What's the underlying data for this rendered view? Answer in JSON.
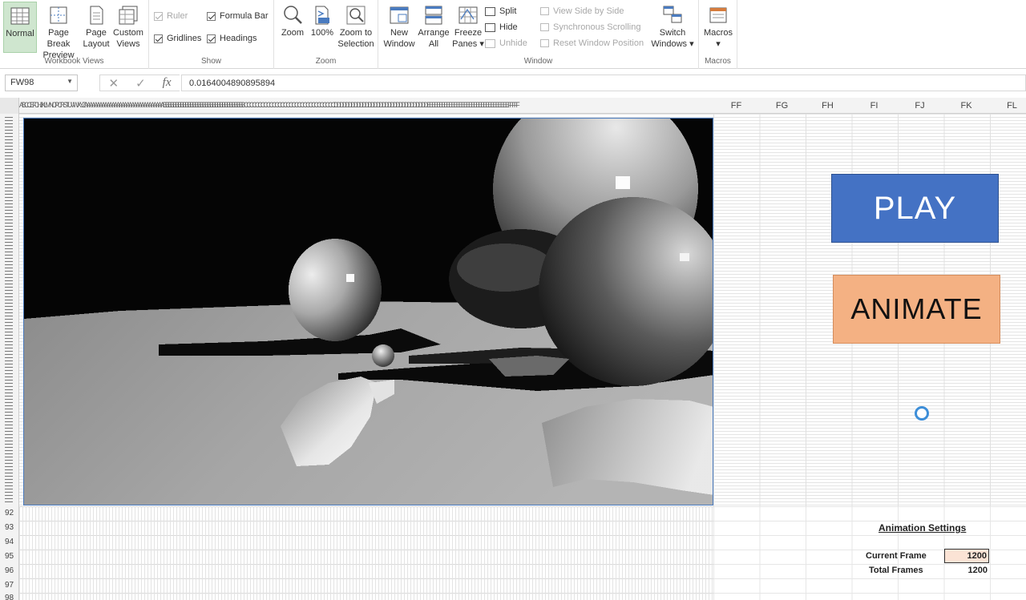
{
  "ribbon": {
    "workbook_views": {
      "label": "Workbook Views",
      "normal": "Normal",
      "page_break": [
        "Page Break",
        "Preview"
      ],
      "page_layout": [
        "Page",
        "Layout"
      ],
      "custom_views": [
        "Custom",
        "Views"
      ]
    },
    "show": {
      "label": "Show",
      "ruler": "Ruler",
      "formula_bar": "Formula Bar",
      "gridlines": "Gridlines",
      "headings": "Headings"
    },
    "zoom": {
      "label": "Zoom",
      "zoom": "Zoom",
      "hundred": "100%",
      "zoom_to_selection": [
        "Zoom to",
        "Selection"
      ]
    },
    "window": {
      "label": "Window",
      "new_window": [
        "New",
        "Window"
      ],
      "arrange_all": [
        "Arrange",
        "All"
      ],
      "freeze_panes": [
        "Freeze",
        "Panes ▾"
      ],
      "split": "Split",
      "hide": "Hide",
      "unhide": "Unhide",
      "view_side_by_side": "View Side by Side",
      "synchronous_scrolling": "Synchronous Scrolling",
      "reset_window_position": "Reset Window Position",
      "switch_windows": [
        "Switch",
        "Windows ▾"
      ]
    },
    "macros": {
      "label": "Macros",
      "macros": "Macros",
      "arrow": "▾"
    }
  },
  "formula_bar": {
    "name_box": "FW98",
    "cancel_icon": "✕",
    "enter_icon": "✓",
    "fx": "fx",
    "value": "0.0164004890895894"
  },
  "columns": {
    "narrow_strip": "ABCCEFCHIJKLMNOPCRSTUVWXYZAAAAAAAAAAAAAAAAAAAAAAAAAAAAAAAABBBBBBBBBBBBBBBBBBBBBBBBBBBBBBBBBCCCCCCCCCCCCCCCCCCCCCCCCCCCCCCCCDDDDDDDDDDDDDDDDDDDDDDDDDDDDDDDDDEEEEEEEEEEEEEEEEEEEEEEEEEEEEEEEEEFFFFF",
    "wide": [
      "FF",
      "FG",
      "FH",
      "FI",
      "FJ",
      "FK",
      "FL"
    ]
  },
  "rows": [
    "92",
    "93",
    "94",
    "95",
    "96",
    "97",
    "98"
  ],
  "buttons": {
    "play": "PLAY",
    "animate": "ANIMATE"
  },
  "settings": {
    "title": "Animation Settings",
    "current_frame_label": "Current Frame",
    "current_frame_value": "1200",
    "total_frames_label": "Total Frames",
    "total_frames_value": "1200"
  },
  "colors": {
    "play_fill": "#4472c4",
    "animate_fill": "#f4b183",
    "normal_view_active": "#cfe6cf",
    "current_frame_fill": "#fbe3d5"
  }
}
